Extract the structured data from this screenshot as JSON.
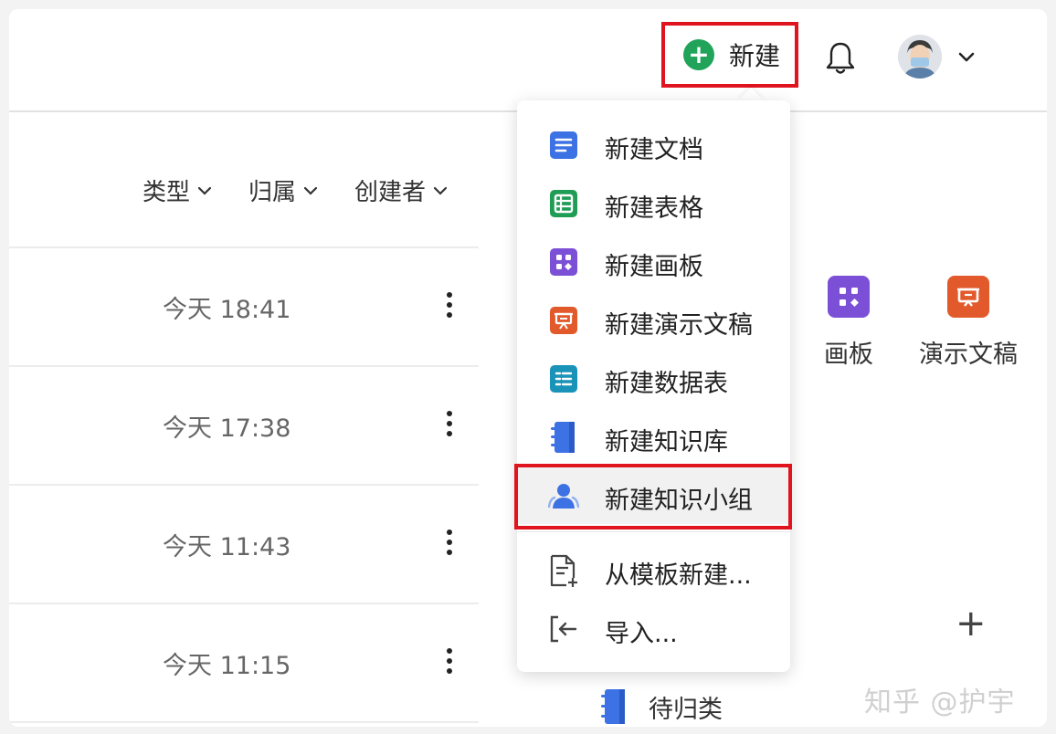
{
  "header": {
    "new_button_label": "新建",
    "new_button_icon": "plus-circle-icon",
    "bell_icon": "bell-icon",
    "avatar_icon": "user-avatar",
    "accent_color": "#21a45a",
    "highlight_color": "#e0141e"
  },
  "filters": [
    {
      "label": "类型"
    },
    {
      "label": "归属"
    },
    {
      "label": "创建者"
    }
  ],
  "rows": [
    {
      "time": "今天 18:41"
    },
    {
      "time": "今天 17:38"
    },
    {
      "time": "今天 11:43"
    },
    {
      "time": "今天 11:15"
    }
  ],
  "quick_create": [
    {
      "label": "画板",
      "icon": "board-icon",
      "color": "#7b4fd6"
    },
    {
      "label": "演示文稿",
      "icon": "presentation-icon",
      "color": "#e25a2c"
    }
  ],
  "quick_add_label": "+",
  "pending": {
    "label": "待归类",
    "icon": "notebook-icon"
  },
  "watermark": "知乎 @护宇",
  "menu": {
    "items": [
      {
        "label": "新建文档",
        "icon": "doc-icon",
        "color": "#3d72e4"
      },
      {
        "label": "新建表格",
        "icon": "sheet-icon",
        "color": "#1f9d55"
      },
      {
        "label": "新建画板",
        "icon": "board-icon",
        "color": "#7b4fd6"
      },
      {
        "label": "新建演示文稿",
        "icon": "presentation-icon",
        "color": "#e25a2c"
      },
      {
        "label": "新建数据表",
        "icon": "datatable-icon",
        "color": "#1a93b8"
      },
      {
        "label": "新建知识库",
        "icon": "knowledge-base-icon",
        "color": "#3d72e4"
      },
      {
        "label": "新建知识小组",
        "icon": "group-icon",
        "color": "#3d72e4"
      }
    ],
    "secondary_items": [
      {
        "label": "从模板新建...",
        "icon": "template-icon"
      },
      {
        "label": "导入...",
        "icon": "import-icon"
      }
    ]
  }
}
